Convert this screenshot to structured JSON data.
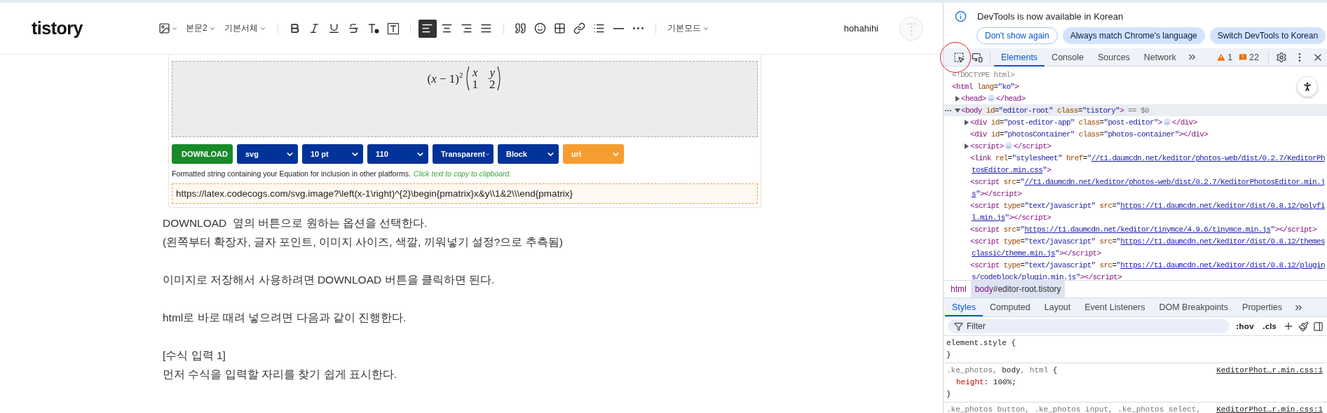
{
  "editor": {
    "logo": "tistory",
    "toolbar": [
      {
        "kind": "image"
      },
      {
        "kind": "menu",
        "label": "본문2"
      },
      {
        "kind": "menu",
        "label": "기본서체"
      },
      {
        "kind": "divider"
      },
      {
        "kind": "bold"
      },
      {
        "kind": "italic"
      },
      {
        "kind": "underline"
      },
      {
        "kind": "strike"
      },
      {
        "kind": "text_color"
      },
      {
        "kind": "text_bg"
      },
      {
        "kind": "divider"
      },
      {
        "kind": "align_left",
        "selected": true
      },
      {
        "kind": "align_center",
        "selected": false
      },
      {
        "kind": "align_right",
        "selected": false
      },
      {
        "kind": "align_justify",
        "selected": false
      },
      {
        "kind": "divider"
      },
      {
        "kind": "quote"
      },
      {
        "kind": "emoticon"
      },
      {
        "kind": "table"
      },
      {
        "kind": "link"
      },
      {
        "kind": "list"
      },
      {
        "kind": "rule"
      },
      {
        "kind": "more"
      },
      {
        "kind": "divider"
      },
      {
        "kind": "menu",
        "label": "기본모드"
      }
    ],
    "user": "hohahihi",
    "widget": {
      "expression": "(*x* − 1)$^{2}$",
      "matrix": [
        [
          "*x*",
          "*y*"
        ],
        [
          "1",
          "2"
        ]
      ],
      "controls": [
        {
          "kind": "button",
          "label": "DOWNLOAD",
          "color": "#178a2a"
        },
        {
          "kind": "select",
          "label": "svg",
          "color": "#003399"
        },
        {
          "kind": "select",
          "label": "10 pt",
          "color": "#003399"
        },
        {
          "kind": "select",
          "label": "110",
          "color": "#003399"
        },
        {
          "kind": "select",
          "label": "Transparent",
          "color": "#003399"
        },
        {
          "kind": "select",
          "label": "Block",
          "color": "#003399"
        },
        {
          "kind": "select",
          "label": "url",
          "color": "#f59d30"
        }
      ],
      "caption": "Formatted string containing your Equation for inclusion in other platforms.",
      "copy_hint": "Click text to copy to clipboard.",
      "url": "https://latex.codecogs.com/svg.image?\\left(x-1\\right)^{2}\\begin{pmatrix}x&y\\\\1&2\\\\\\end{pmatrix}"
    },
    "paragraphs": [
      [
        "DOWNLOAD  옆의 버튼으로 원하는 옵션을 선택한다.",
        "(왼쪽부터 확장자, 글자 포인트, 이미지 사이즈, 색깔, 끼워넣기 설정?으로 추측됨)"
      ],
      [
        "이미지로 저장해서 사용하려면 DOWNLOAD 버튼을 클릭하면 된다."
      ],
      [
        "html로 바로 때려 넣으려면 다음과 같이 진행한다."
      ],
      [
        "[수식 입력 1]",
        "먼저 수식을 입력할 자리를 찾기 쉽게 표시한다."
      ]
    ]
  },
  "devtools": {
    "notice": {
      "text": "DevTools is now available in Korean",
      "buttons": [
        {
          "kind": "outline",
          "label": "Don't show again"
        },
        {
          "kind": "filled",
          "label": "Always match Chrome's language"
        },
        {
          "kind": "filled",
          "label": "Switch DevTools to Korean"
        }
      ]
    },
    "tabs": [
      {
        "label": "Elements",
        "selected": true
      },
      {
        "label": "Console",
        "selected": false
      },
      {
        "label": "Sources",
        "selected": false
      },
      {
        "label": "Network",
        "selected": false
      }
    ],
    "warnings": "1",
    "issues": "22",
    "dom": [
      {
        "selected": false,
        "lines": [
          [
            {
              "kind": "comment",
              "text": "<!DOCTYPE html>"
            }
          ]
        ]
      },
      {
        "selected": false,
        "lines": [
          [
            {
              "kind": "tag",
              "text": "<html"
            },
            {
              "kind": "attr",
              "text": " lang"
            },
            {
              "kind": "plain",
              "text": "="
            },
            {
              "kind": "value",
              "text": "\"ko\""
            },
            {
              "kind": "tag",
              "text": ">"
            }
          ]
        ],
        "children": [
          {
            "selected": false,
            "expanded": false,
            "lines": [
              [
                {
                  "kind": "tag",
                  "text": "<head>"
                },
                {
                  "kind": "badge",
                  "text": "…"
                },
                {
                  "kind": "tag",
                  "text": "</head>"
                }
              ]
            ]
          },
          {
            "selected": true,
            "expanded": true,
            "lines": [
              [
                {
                  "kind": "tag",
                  "text": "<body"
                },
                {
                  "kind": "attr",
                  "text": " id"
                },
                {
                  "kind": "plain",
                  "text": "="
                },
                {
                  "kind": "value",
                  "text": "\"editor-root\""
                },
                {
                  "kind": "attr",
                  "text": " class"
                },
                {
                  "kind": "plain",
                  "text": "="
                },
                {
                  "kind": "value",
                  "text": "\"tistory\""
                },
                {
                  "kind": "tag",
                  "text": ">"
                },
                {
                  "kind": "hint",
                  "text": " == $0"
                }
              ]
            ],
            "children": [
              {
                "selected": false,
                "expanded": false,
                "lines": [
                  [
                    {
                      "kind": "tag",
                      "text": "<div"
                    },
                    {
                      "kind": "attr",
                      "text": " id"
                    },
                    {
                      "kind": "plain",
                      "text": "="
                    },
                    {
                      "kind": "value",
                      "text": "\"post-editor-app\""
                    },
                    {
                      "kind": "attr",
                      "text": " class"
                    },
                    {
                      "kind": "plain",
                      "text": "="
                    },
                    {
                      "kind": "value",
                      "text": "\"post-editor\""
                    },
                    {
                      "kind": "tag",
                      "text": ">"
                    },
                    {
                      "kind": "badge",
                      "text": "…"
                    },
                    {
                      "kind": "tag",
                      "text": "</div>"
                    }
                  ]
                ]
              },
              {
                "selected": false,
                "lines": [
                  [
                    {
                      "kind": "tag",
                      "text": "<div"
                    },
                    {
                      "kind": "attr",
                      "text": " id"
                    },
                    {
                      "kind": "plain",
                      "text": "="
                    },
                    {
                      "kind": "value",
                      "text": "\"photosContainer\""
                    },
                    {
                      "kind": "attr",
                      "text": " class"
                    },
                    {
                      "kind": "plain",
                      "text": "="
                    },
                    {
                      "kind": "value",
                      "text": "\"photos-container\""
                    },
                    {
                      "kind": "tag",
                      "text": "></div>"
                    }
                  ]
                ]
              },
              {
                "selected": false,
                "expanded": false,
                "lines": [
                  [
                    {
                      "kind": "tag",
                      "text": "<script>"
                    },
                    {
                      "kind": "badge",
                      "text": "…"
                    },
                    {
                      "kind": "tag",
                      "text": "</script>"
                    }
                  ]
                ]
              },
              {
                "selected": false,
                "lines": [
                  [
                    {
                      "kind": "tag",
                      "text": "<link"
                    },
                    {
                      "kind": "attr",
                      "text": " rel"
                    },
                    {
                      "kind": "plain",
                      "text": "="
                    },
                    {
                      "kind": "value",
                      "text": "\"stylesheet\""
                    },
                    {
                      "kind": "attr",
                      "text": " href"
                    },
                    {
                      "kind": "plain",
                      "text": "="
                    },
                    {
                      "kind": "value",
                      "text": "\""
                    },
                    {
                      "kind": "link",
                      "text": "//t1.daumcdn.net/keditor/photos-web/dist/0.2.7/KeditorPh"
                    }
                  ],
                  [
                    {
                      "kind": "link",
                      "text": "tosEditor.min.css"
                    },
                    {
                      "kind": "value",
                      "text": "\""
                    },
                    {
                      "kind": "tag",
                      "text": ">"
                    }
                  ]
                ]
              },
              {
                "selected": false,
                "lines": [
                  [
                    {
                      "kind": "tag",
                      "text": "<script"
                    },
                    {
                      "kind": "attr",
                      "text": " src"
                    },
                    {
                      "kind": "plain",
                      "text": "="
                    },
                    {
                      "kind": "value",
                      "text": "\""
                    },
                    {
                      "kind": "link",
                      "text": "//t1.daumcdn.net/keditor/photos-web/dist/0.2.7/KeditorPhotosEditor.min.j"
                    }
                  ],
                  [
                    {
                      "kind": "link",
                      "text": "s"
                    },
                    {
                      "kind": "value",
                      "text": "\""
                    },
                    {
                      "kind": "tag",
                      "text": "></script>"
                    }
                  ]
                ]
              },
              {
                "selected": false,
                "lines": [
                  [
                    {
                      "kind": "tag",
                      "text": "<script"
                    },
                    {
                      "kind": "attr",
                      "text": " type"
                    },
                    {
                      "kind": "plain",
                      "text": "="
                    },
                    {
                      "kind": "value",
                      "text": "\"text/javascript\""
                    },
                    {
                      "kind": "attr",
                      "text": " src"
                    },
                    {
                      "kind": "plain",
                      "text": "="
                    },
                    {
                      "kind": "value",
                      "text": "\""
                    },
                    {
                      "kind": "link",
                      "text": "https://t1.daumcdn.net/keditor/dist/0.8.12/polyfi"
                    }
                  ],
                  [
                    {
                      "kind": "link",
                      "text": "l.min.js"
                    },
                    {
                      "kind": "value",
                      "text": "\""
                    },
                    {
                      "kind": "tag",
                      "text": "></script>"
                    }
                  ]
                ]
              },
              {
                "selected": false,
                "lines": [
                  [
                    {
                      "kind": "tag",
                      "text": "<script"
                    },
                    {
                      "kind": "attr",
                      "text": " src"
                    },
                    {
                      "kind": "plain",
                      "text": "="
                    },
                    {
                      "kind": "value",
                      "text": "\""
                    },
                    {
                      "kind": "link",
                      "text": "https://t1.daumcdn.net/keditor/tinymce/4.9.6/tinymce.min.js"
                    },
                    {
                      "kind": "value",
                      "text": "\""
                    },
                    {
                      "kind": "tag",
                      "text": "></script>"
                    }
                  ]
                ]
              },
              {
                "selected": false,
                "lines": [
                  [
                    {
                      "kind": "tag",
                      "text": "<script"
                    },
                    {
                      "kind": "attr",
                      "text": " type"
                    },
                    {
                      "kind": "plain",
                      "text": "="
                    },
                    {
                      "kind": "value",
                      "text": "\"text/javascript\""
                    },
                    {
                      "kind": "attr",
                      "text": " src"
                    },
                    {
                      "kind": "plain",
                      "text": "="
                    },
                    {
                      "kind": "value",
                      "text": "\""
                    },
                    {
                      "kind": "link",
                      "text": "https://t1.daumcdn.net/keditor/dist/0.8.12/themes"
                    }
                  ],
                  [
                    {
                      "kind": "link",
                      "text": "classic/theme.min.js"
                    },
                    {
                      "kind": "value",
                      "text": "\""
                    },
                    {
                      "kind": "tag",
                      "text": "></script>"
                    }
                  ]
                ]
              },
              {
                "selected": false,
                "lines": [
                  [
                    {
                      "kind": "tag",
                      "text": "<script"
                    },
                    {
                      "kind": "attr",
                      "text": " type"
                    },
                    {
                      "kind": "plain",
                      "text": "="
                    },
                    {
                      "kind": "value",
                      "text": "\"text/javascript\""
                    },
                    {
                      "kind": "attr",
                      "text": " src"
                    },
                    {
                      "kind": "plain",
                      "text": "="
                    },
                    {
                      "kind": "value",
                      "text": "\""
                    },
                    {
                      "kind": "link",
                      "text": "https://t1.daumcdn.net/keditor/dist/0.8.12/plugin"
                    }
                  ],
                  [
                    {
                      "kind": "link",
                      "text": "s/codeblock/plugin.min.js"
                    },
                    {
                      "kind": "value",
                      "text": "\""
                    },
                    {
                      "kind": "tag",
                      "text": "></script>"
                    }
                  ]
                ]
              }
            ]
          }
        ]
      }
    ],
    "breadcrumbs": [
      {
        "tag": "html",
        "selected": false
      },
      {
        "tag": "body",
        "rest": "#editor-root.tistory",
        "selected": true
      }
    ],
    "style_tabs": [
      {
        "label": "Styles",
        "selected": true
      },
      {
        "label": "Computed",
        "selected": false
      },
      {
        "label": "Layout",
        "selected": false
      },
      {
        "label": "Event Listeners",
        "selected": false
      },
      {
        "label": "DOM Breakpoints",
        "selected": false
      },
      {
        "label": "Properties",
        "selected": false
      }
    ],
    "filter": {
      "placeholder": "Filter"
    },
    "filter_tools": [
      ":hov",
      ".cls"
    ],
    "rules": [
      {
        "selector": [
          {
            "kind": "matched",
            "text": "element.style {"
          }
        ],
        "close": "}"
      },
      {
        "selector": [
          {
            "kind": "unmatched",
            "text": ".ke_photos, "
          },
          {
            "kind": "matched",
            "text": "body"
          },
          {
            "kind": "unmatched",
            "text": ", html"
          },
          {
            "kind": "matched",
            "text": " {"
          }
        ],
        "source": "KeditorPhot…r.min.css:1",
        "declarations": [
          [
            {
              "kind": "prop",
              "text": "height"
            },
            {
              "kind": "plain",
              "text": ": 100%;"
            }
          ]
        ],
        "close": "}"
      },
      {
        "selector": [
          {
            "kind": "unmatched",
            "text": ".ke_photos button, .ke_photos input, .ke_photos select,"
          }
        ],
        "source": "KeditorPhot…r.min.css:1"
      }
    ]
  }
}
